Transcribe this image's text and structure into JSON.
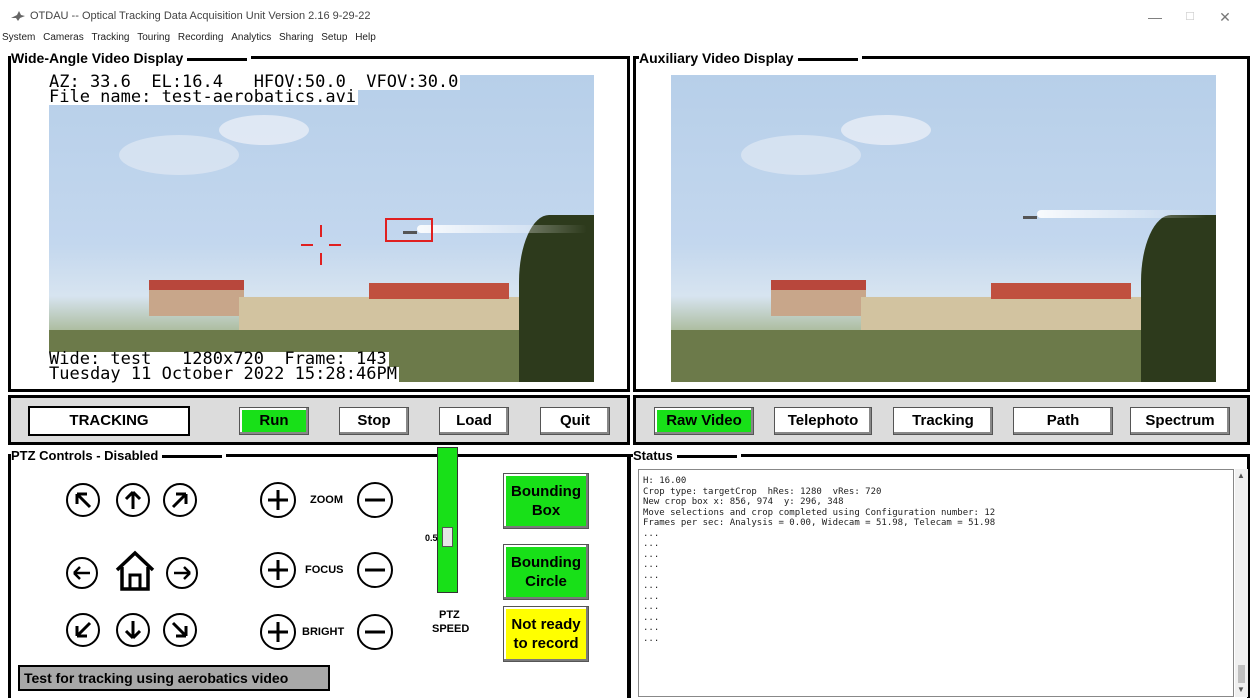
{
  "window": {
    "title": "OTDAU -- Optical Tracking Data Acquisition Unit   Version 2.16  9-29-22",
    "minimize": "—",
    "maximize": "☐",
    "close": "✕"
  },
  "menu": [
    "System",
    "Cameras",
    "Tracking",
    "Touring",
    "Recording",
    "Analytics",
    "Sharing",
    "Setup",
    "Help"
  ],
  "wide": {
    "title": "Wide-Angle Video Display",
    "overlay_top_1": "AZ: 33.6  EL:16.4   HFOV:50.0  VFOV:30.0",
    "overlay_top_2": "File name: test-aerobatics.avi",
    "overlay_bottom_1": "Wide: test   1280x720  Frame: 143",
    "overlay_bottom_2": "Tuesday 11 October 2022 15:28:46PM"
  },
  "aux": {
    "title": "Auxiliary Video Display"
  },
  "left_bar": {
    "tracking": "TRACKING",
    "run": "Run",
    "stop": "Stop",
    "load": "Load",
    "quit": "Quit"
  },
  "right_bar": {
    "raw": "Raw Video",
    "telephoto": "Telephoto",
    "tracking": "Tracking",
    "path": "Path",
    "spectrum": "Spectrum"
  },
  "ptz": {
    "title": "PTZ Controls - Disabled",
    "zoom": "ZOOM",
    "focus": "FOCUS",
    "bright": "BRIGHT",
    "speed_value": "0.5",
    "speed_label_1": "PTZ",
    "speed_label_2": "SPEED",
    "bounding_box_1": "Bounding",
    "bounding_box_2": "Box",
    "bounding_circle_1": "Bounding",
    "bounding_circle_2": "Circle",
    "record_1": "Not ready",
    "record_2": "to record",
    "message": "Test for tracking using aerobatics video"
  },
  "status": {
    "title": "Status",
    "lines": [
      "H: 16.00",
      "Crop type: targetCrop  hRes: 1280  vRes: 720",
      "New crop box x: 856, 974  y: 296, 348",
      "Move selections and crop completed using Configuration number: 12",
      "Frames per sec: Analysis = 0.00, Widecam = 51.98, Telecam = 51.98",
      "",
      "...",
      "...",
      "...",
      "...",
      "...",
      "...",
      "...",
      "...",
      "...",
      "...",
      "..."
    ]
  },
  "colors": {
    "green": "#18e018",
    "yellow": "#ffff00",
    "reticle": "#e02020"
  }
}
